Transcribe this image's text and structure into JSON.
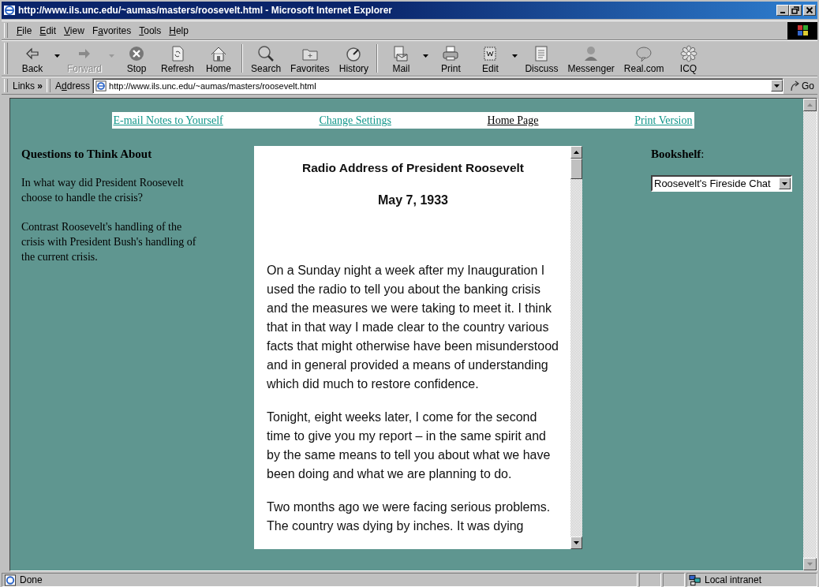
{
  "window": {
    "title": "http://www.ils.unc.edu/~aumas/masters/roosevelt.html - Microsoft Internet Explorer"
  },
  "menu": [
    {
      "key": "F",
      "rest": "ile"
    },
    {
      "key": "E",
      "rest": "dit"
    },
    {
      "key": "V",
      "rest": "iew"
    },
    {
      "pre": "F",
      "key": "a",
      "rest": "vorites"
    },
    {
      "key": "T",
      "rest": "ools"
    },
    {
      "key": "H",
      "rest": "elp"
    }
  ],
  "toolbar": [
    [
      {
        "label": "Back",
        "disabled": false,
        "dropdown": true
      },
      {
        "label": "Forward",
        "disabled": true,
        "dropdown": true
      },
      {
        "label": "Stop",
        "disabled": false,
        "dropdown": false
      },
      {
        "label": "Refresh",
        "disabled": false,
        "dropdown": false
      },
      {
        "label": "Home",
        "disabled": false,
        "dropdown": false
      }
    ],
    [
      {
        "label": "Search",
        "disabled": false,
        "dropdown": false
      },
      {
        "label": "Favorites",
        "disabled": false,
        "dropdown": false
      },
      {
        "label": "History",
        "disabled": false,
        "dropdown": false
      }
    ],
    [
      {
        "label": "Mail",
        "disabled": false,
        "dropdown": true
      },
      {
        "label": "Print",
        "disabled": false,
        "dropdown": false
      },
      {
        "label": "Edit",
        "disabled": false,
        "dropdown": true
      },
      {
        "label": "Discuss",
        "disabled": false,
        "dropdown": false
      },
      {
        "label": "Messenger",
        "disabled": false,
        "dropdown": false
      },
      {
        "label": "Real.com",
        "disabled": false,
        "dropdown": false
      },
      {
        "label": "ICQ",
        "disabled": false,
        "dropdown": false
      }
    ]
  ],
  "address_bar": {
    "links": "Links",
    "chevron": "»",
    "label": {
      "pre": "A",
      "key": "d",
      "rest": "dress"
    },
    "url": "http://www.ils.unc.edu/~aumas/masters/roosevelt.html",
    "go": "Go"
  },
  "nav_links": [
    {
      "label": "E-mail Notes to Yourself",
      "visited": false
    },
    {
      "label": "Change Settings",
      "visited": false
    },
    {
      "label": "Home Page",
      "visited": true
    },
    {
      "label": "Print Version",
      "visited": false
    }
  ],
  "questions": {
    "heading": "Questions to Think About",
    "items": [
      "In what way did President Roosevelt choose to handle the crisis?",
      "Contrast Roosevelt's handling of the crisis with President Bush's handling of the current crisis."
    ]
  },
  "article": {
    "title": "Radio Address of President Roosevelt",
    "date": "May 7, 1933",
    "paragraphs": [
      "On a Sunday night a week after my Inauguration I used the radio to tell you about the banking crisis and the measures we were taking to meet it. I think that in that way I made clear to the country various facts that might otherwise have been misunderstood and in general provided a means of understanding which did much to restore confidence.",
      "Tonight, eight weeks later, I come for the second time to give you my report – in the same spirit and by the same means to tell you about what we have been doing and what we are planning to do.",
      "Two months ago we were facing serious problems. The country was dying by inches. It was dying"
    ]
  },
  "bookshelf": {
    "label": "**Bookshelf**:",
    "value": "Roosevelt's Fireside Chat"
  },
  "status_bar": {
    "text": "Done",
    "zone": "Local intranet"
  }
}
